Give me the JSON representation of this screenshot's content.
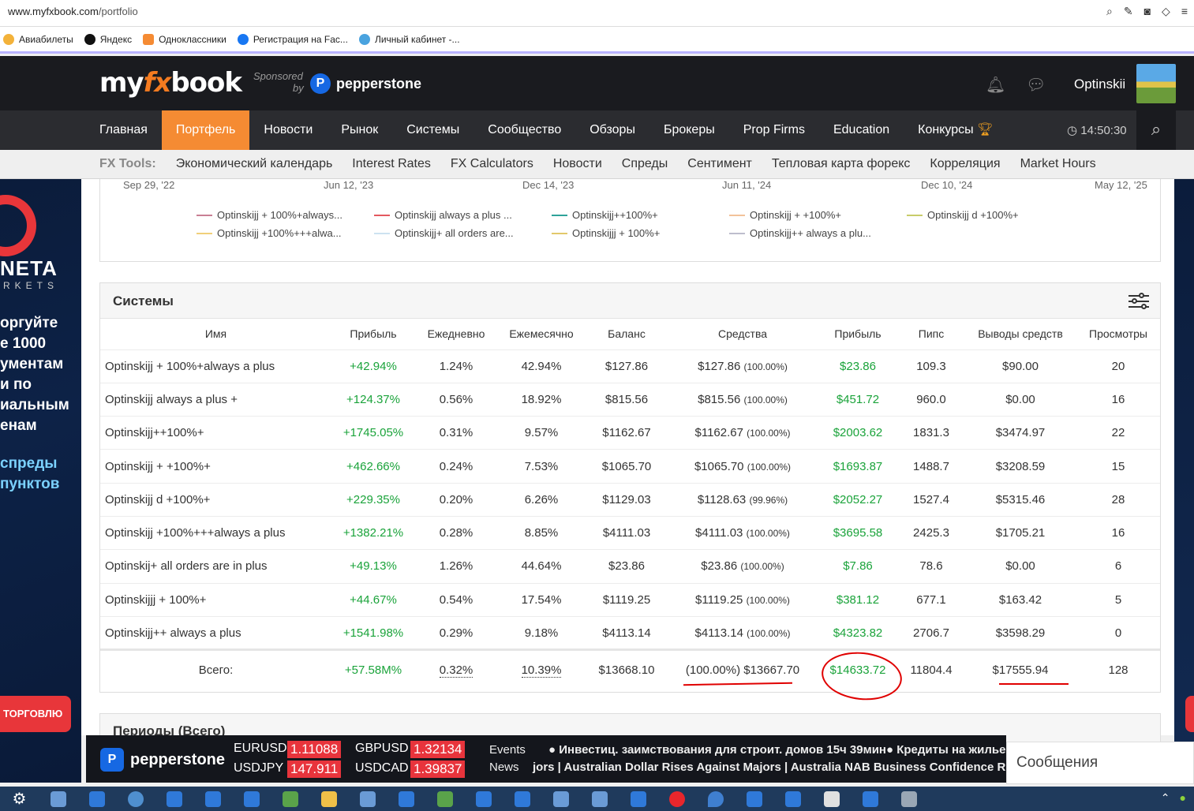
{
  "browser": {
    "url_host": "www.myfxbook.com",
    "url_path": "/portfolio",
    "bookmarks": [
      "Авиабилеты",
      "Яндекс",
      "Одноклассники",
      "Регистрация на Fac...",
      "Личный кабинет -..."
    ]
  },
  "header": {
    "logo": {
      "a": "my",
      "b": "fx",
      "c": "book"
    },
    "sponsored": "Sponsored",
    "by": "by",
    "sponsor_name": "pepperstone",
    "username": "Optinskii"
  },
  "nav": {
    "items": [
      "Главная",
      "Портфель",
      "Новости",
      "Рынок",
      "Системы",
      "Сообщество",
      "Обзоры",
      "Брокеры",
      "Prop Firms",
      "Education",
      "Конкурсы"
    ],
    "time": "14:50:30"
  },
  "subnav": {
    "title": "FX Tools:",
    "items": [
      "Экономический календарь",
      "Interest Rates",
      "FX Calculators",
      "Новости",
      "Спреды",
      "Сентимент",
      "Тепловая карта форекс",
      "Корреляция",
      "Market Hours"
    ]
  },
  "ad": {
    "brand": "NETA",
    "sub": "RKETS",
    "line1": "оргуйте",
    "line2": "е 1000",
    "line3": "ументам",
    "line4": "и по",
    "line5": "иальным",
    "line6": "енам",
    "line7": "спреды",
    "line8": "пунктов",
    "cta": "ТОРГОВЛЮ"
  },
  "chart": {
    "xticks": [
      "Sep 29, '22",
      "Jun 12, '23",
      "Dec 14, '23",
      "Jun 11, '24",
      "Dec 10, '24",
      "May 12, '25"
    ],
    "legend": [
      {
        "label": "Optinskijj + 100%+always...",
        "color": "#c97f94"
      },
      {
        "label": "Optinskijj always a plus ...",
        "color": "#e3585f"
      },
      {
        "label": "Optinskijj++100%+",
        "color": "#2fa39a"
      },
      {
        "label": "Optinskijj + +100%+",
        "color": "#f2c29a"
      },
      {
        "label": "Optinskijj d +100%+",
        "color": "#c8cc6a"
      },
      {
        "label": "Optinskijj +100%+++alwa...",
        "color": "#f0d07a"
      },
      {
        "label": "Optinskijj+ all orders are...",
        "color": "#cde2f0"
      },
      {
        "label": "Optinskijjj + 100%+",
        "color": "#e2c86a"
      },
      {
        "label": "Optinskijj++ always a plu...",
        "color": "#bdbdcd"
      }
    ]
  },
  "systems": {
    "title": "Системы",
    "columns": [
      "Имя",
      "Прибыль",
      "Ежедневно",
      "Ежемесячно",
      "Баланс",
      "Средства",
      "Прибыль",
      "Пипс",
      "Выводы средств",
      "Просмотры"
    ],
    "rows": [
      {
        "name": "Optinskijj + 100%+always a plus",
        "gain": "+42.94%",
        "daily": "1.24%",
        "monthly": "42.94%",
        "balance": "$127.86",
        "equity": "$127.86",
        "equity_pct": "(100.00%)",
        "profit": "$23.86",
        "pips": "109.3",
        "withdrawals": "$90.00",
        "views": "20"
      },
      {
        "name": "Optinskijj always a plus +",
        "gain": "+124.37%",
        "daily": "0.56%",
        "monthly": "18.92%",
        "balance": "$815.56",
        "equity": "$815.56",
        "equity_pct": "(100.00%)",
        "profit": "$451.72",
        "pips": "960.0",
        "withdrawals": "$0.00",
        "views": "16"
      },
      {
        "name": "Optinskijj++100%+",
        "gain": "+1745.05%",
        "daily": "0.31%",
        "monthly": "9.57%",
        "balance": "$1162.67",
        "equity": "$1162.67",
        "equity_pct": "(100.00%)",
        "profit": "$2003.62",
        "pips": "1831.3",
        "withdrawals": "$3474.97",
        "views": "22"
      },
      {
        "name": "Optinskijj + +100%+",
        "gain": "+462.66%",
        "daily": "0.24%",
        "monthly": "7.53%",
        "balance": "$1065.70",
        "equity": "$1065.70",
        "equity_pct": "(100.00%)",
        "profit": "$1693.87",
        "pips": "1488.7",
        "withdrawals": "$3208.59",
        "views": "15"
      },
      {
        "name": "Optinskijj d +100%+",
        "gain": "+229.35%",
        "daily": "0.20%",
        "monthly": "6.26%",
        "balance": "$1129.03",
        "equity": "$1128.63",
        "equity_pct": "(99.96%)",
        "profit": "$2052.27",
        "pips": "1527.4",
        "withdrawals": "$5315.46",
        "views": "28"
      },
      {
        "name": "Optinskijj +100%+++always a plus",
        "gain": "+1382.21%",
        "daily": "0.28%",
        "monthly": "8.85%",
        "balance": "$4111.03",
        "equity": "$4111.03",
        "equity_pct": "(100.00%)",
        "profit": "$3695.58",
        "pips": "2425.3",
        "withdrawals": "$1705.21",
        "views": "16"
      },
      {
        "name": "Optinskij+ all orders are in plus",
        "gain": "+49.13%",
        "daily": "1.26%",
        "monthly": "44.64%",
        "balance": "$23.86",
        "equity": "$23.86",
        "equity_pct": "(100.00%)",
        "profit": "$7.86",
        "pips": "78.6",
        "withdrawals": "$0.00",
        "views": "6"
      },
      {
        "name": "Optinskijjj + 100%+",
        "gain": "+44.67%",
        "daily": "0.54%",
        "monthly": "17.54%",
        "balance": "$1119.25",
        "equity": "$1119.25",
        "equity_pct": "(100.00%)",
        "profit": "$381.12",
        "pips": "677.1",
        "withdrawals": "$163.42",
        "views": "5"
      },
      {
        "name": "Optinskijj++ always a plus",
        "gain": "+1541.98%",
        "daily": "0.29%",
        "monthly": "9.18%",
        "balance": "$4113.14",
        "equity": "$4113.14",
        "equity_pct": "(100.00%)",
        "profit": "$4323.82",
        "pips": "2706.7",
        "withdrawals": "$3598.29",
        "views": "0"
      }
    ],
    "total": {
      "label": "Всего:",
      "gain": "+57.58M%",
      "daily": "0.32%",
      "monthly": "10.39%",
      "balance": "$13668.10",
      "equity": "(100.00%) $13667.70",
      "profit": "$14633.72",
      "pips": "11804.4",
      "withdrawals": "$17555.94",
      "views": "128"
    }
  },
  "periods": {
    "title": "Периоды (Всего)"
  },
  "ticker": {
    "brand": "pepperstone",
    "pairs": [
      {
        "name": "EURUSD",
        "price": "1.11088"
      },
      {
        "name": "GBPUSD",
        "price": "1.32134"
      },
      {
        "name": "USDJPY",
        "price": "147.911"
      },
      {
        "name": "USDCAD",
        "price": "1.39837"
      }
    ],
    "events_label": "Events",
    "news_label": "News",
    "events_text": "● Инвестиц. заимствования для строит. домов   15ч 39мин● Кредиты на жилье кв/кв",
    "news_text": "jors  |  Australian Dollar Rises Against Majors  |  Australia NAB Business Confidence Rise"
  },
  "messages": {
    "label": "Сообщения"
  },
  "colors": {
    "accent": "#f58b33",
    "dark": "#1a1b1f",
    "green": "#1aa33a",
    "annotation": "#e00000"
  }
}
